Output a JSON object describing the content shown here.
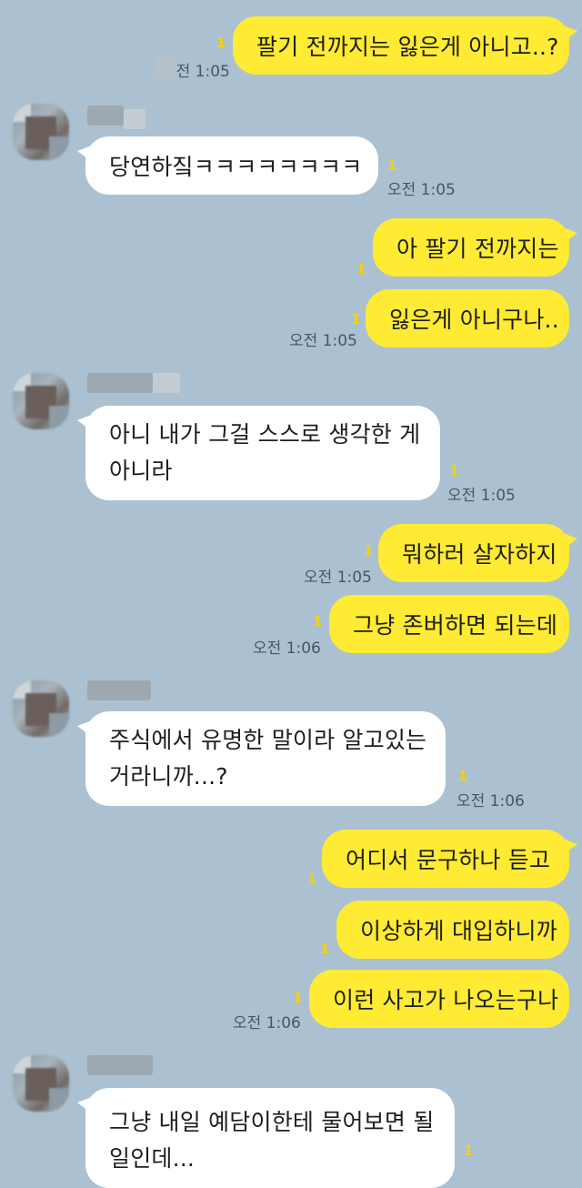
{
  "chat": {
    "m1": {
      "text": "팔기 전까지는 잃은게 아니고..?",
      "unread": "1",
      "time": "오전 1:05"
    },
    "m2": {
      "text": "당연하짘ㅋㅋㅋㅋㅋㅋㅋㅋ",
      "unread": "1",
      "time": "오전 1:05"
    },
    "m3": {
      "text": "아 팔기 전까지는",
      "unread": "1"
    },
    "m4": {
      "text": "잃은게 아니구나..",
      "unread": "1",
      "time": "오전 1:05"
    },
    "m5": {
      "line1": "아니 내가 그걸 스스로 생각한 게",
      "line2": "아니라",
      "unread": "1",
      "time": "오전 1:05"
    },
    "m6": {
      "text": "뭐하러 살자하지",
      "unread": "1",
      "time": "오전 1:05"
    },
    "m7": {
      "text": "그냥 존버하면 되는데",
      "unread": "1",
      "time": "오전 1:06"
    },
    "m8": {
      "line1": "주식에서 유명한 말이라 알고있는",
      "line2": "거라니까...?",
      "unread": "1",
      "time": "오전 1:06"
    },
    "m9": {
      "text": "어디서 문구하나 듣고",
      "unread": "1"
    },
    "m10": {
      "text": "이상하게 대입하니까",
      "unread": "1"
    },
    "m11": {
      "text": "이런 사고가 나오는구나",
      "unread": "1",
      "time": "오전 1:06"
    },
    "m12": {
      "line1": "그냥 내일 예담이한테 물어보면 될",
      "line2": "일인데...",
      "unread": "1"
    }
  },
  "colors": {
    "background": "#abc1d1",
    "my_bubble": "#ffeb33",
    "their_bubble": "#ffffff",
    "unread": "#f5d200"
  }
}
